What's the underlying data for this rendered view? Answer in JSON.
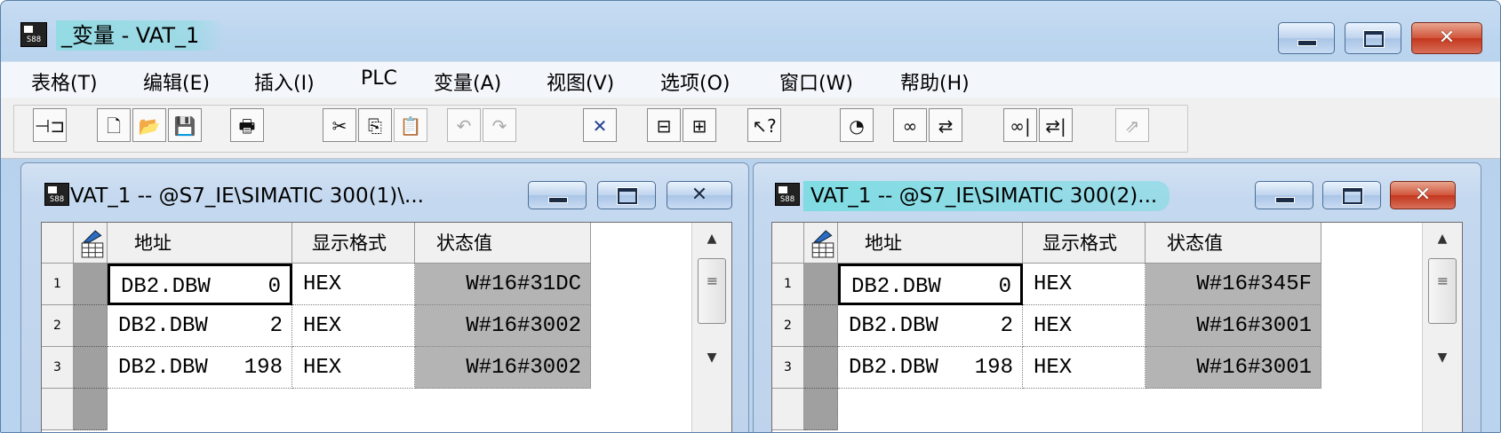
{
  "window": {
    "title": "_变量 - VAT_1",
    "icon_label": "S88",
    "minimize": "minimize",
    "maximize": "maximize",
    "close": "close"
  },
  "menu": [
    {
      "label": "表格(T)"
    },
    {
      "label": "编辑(E)"
    },
    {
      "label": "插入(I)"
    },
    {
      "label": "PLC"
    },
    {
      "label": "变量(A)"
    },
    {
      "label": "视图(V)"
    },
    {
      "label": "选项(O)"
    },
    {
      "label": "窗口(W)"
    },
    {
      "label": "帮助(H)"
    }
  ],
  "toolbar": [
    {
      "icon": "pin-icon",
      "glyph": "⊣⊐"
    },
    {
      "icon": "new-file-icon",
      "glyph": "🗋"
    },
    {
      "icon": "open-folder-icon",
      "glyph": "📂"
    },
    {
      "icon": "save-icon",
      "glyph": "💾"
    },
    {
      "icon": "print-icon",
      "glyph": "🖶"
    },
    {
      "icon": "cut-icon",
      "glyph": "✂"
    },
    {
      "icon": "copy-icon",
      "glyph": "⎘"
    },
    {
      "icon": "paste-icon",
      "glyph": "📋"
    },
    {
      "icon": "undo-icon",
      "glyph": "↶"
    },
    {
      "icon": "redo-icon",
      "glyph": "↷"
    },
    {
      "icon": "delete-icon",
      "glyph": "✕"
    },
    {
      "icon": "online-icon",
      "glyph": "⊟"
    },
    {
      "icon": "station-icon",
      "glyph": "⊞"
    },
    {
      "icon": "help-pointer-icon",
      "glyph": "↖?"
    },
    {
      "icon": "monitor-trigger-icon",
      "glyph": "◔"
    },
    {
      "icon": "monitor-glasses-icon",
      "glyph": "∞"
    },
    {
      "icon": "modify-icon",
      "glyph": "⇄"
    },
    {
      "icon": "monitor-once-icon",
      "glyph": "∞|"
    },
    {
      "icon": "modify-once-icon",
      "glyph": "⇄|"
    },
    {
      "icon": "force-icon",
      "glyph": "⇗"
    }
  ],
  "tables": [
    {
      "title": "VAT_1 -- @S7_IE\\SIMATIC 300(1)\\...",
      "columns": {
        "address": "地址",
        "format": "显示格式",
        "status": "状态值"
      },
      "rows": [
        {
          "num": "1",
          "addr": "DB2.DBW",
          "offset": "0",
          "format": "HEX",
          "status": "W#16#31DC"
        },
        {
          "num": "2",
          "addr": "DB2.DBW",
          "offset": "2",
          "format": "HEX",
          "status": "W#16#3002"
        },
        {
          "num": "3",
          "addr": "DB2.DBW",
          "offset": "198",
          "format": "HEX",
          "status": "W#16#3002"
        }
      ]
    },
    {
      "title": "VAT_1 -- @S7_IE\\SIMATIC 300(2)...",
      "columns": {
        "address": "地址",
        "format": "显示格式",
        "status": "状态值"
      },
      "rows": [
        {
          "num": "1",
          "addr": "DB2.DBW",
          "offset": "0",
          "format": "HEX",
          "status": "W#16#345F"
        },
        {
          "num": "2",
          "addr": "DB2.DBW",
          "offset": "2",
          "format": "HEX",
          "status": "W#16#3001"
        },
        {
          "num": "3",
          "addr": "DB2.DBW",
          "offset": "198",
          "format": "HEX",
          "status": "W#16#3001"
        }
      ]
    }
  ]
}
